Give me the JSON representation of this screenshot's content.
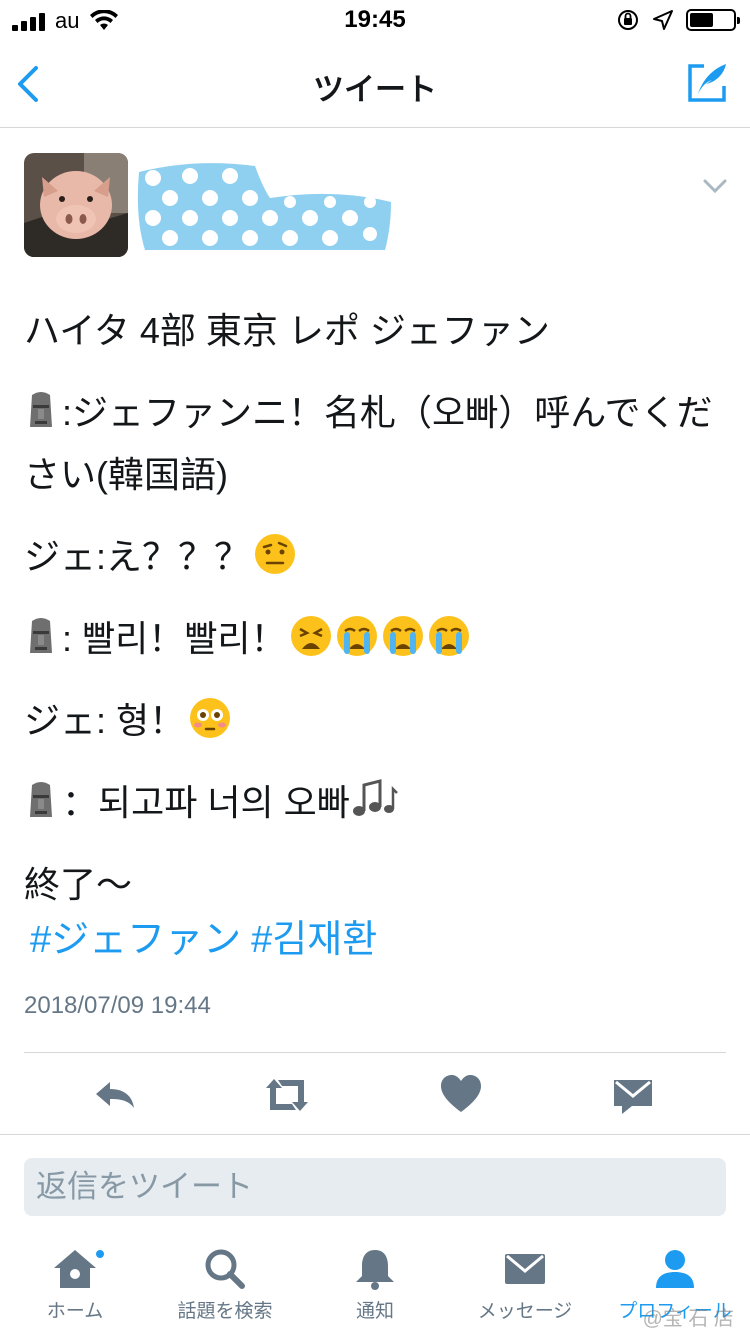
{
  "status_bar": {
    "carrier": "au",
    "time": "19:45",
    "battery_level": 0.55
  },
  "nav": {
    "title": "ツイート"
  },
  "tweet": {
    "lines": {
      "line1": "ハイタ 4部 東京 レポ ジェファン",
      "line2": ":ジェファンニ！名札（오빠）呼んでください(韓国語)",
      "line3": "ジェ:え？？？",
      "line4": ": 빨리！빨리！",
      "line5": "ジェ: 형！",
      "line6": "：되고파 너의 오빠",
      "line7": "終了〜"
    },
    "hashtags": [
      "#ジェファン",
      "#김재환"
    ],
    "timestamp": "2018/07/09 19:44"
  },
  "reply": {
    "placeholder": "返信をツイート"
  },
  "tabbar": {
    "home": "ホーム",
    "search": "話題を検索",
    "notifications": "通知",
    "messages": "メッセージ",
    "profile": "プロフィール"
  },
  "watermark": "@宝 石 店",
  "colors": {
    "accent": "#1d9bf0",
    "icon_gray": "#657786"
  }
}
